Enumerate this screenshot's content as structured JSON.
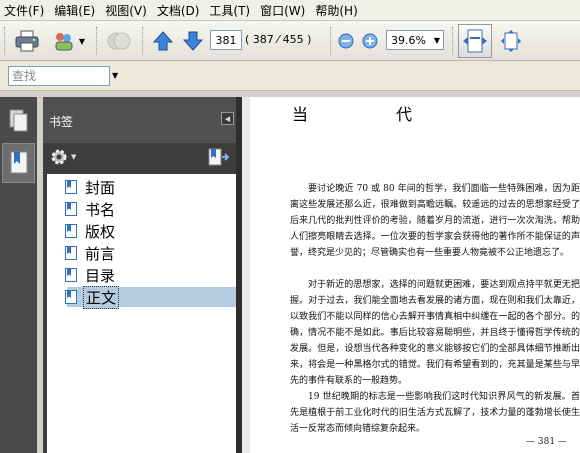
{
  "menu": [
    "文件(F)",
    "编辑(E)",
    "视图(V)",
    "文档(D)",
    "工具(T)",
    "窗口(W)",
    "帮助(H)"
  ],
  "toolbar": {
    "current_page": "381",
    "page_count": "( 387 ⁄ 455 )",
    "zoom": "39.6%",
    "icons": [
      "print-icon",
      "collaborate-icon",
      "security-icon",
      "previous-page-icon",
      "next-page-icon",
      "zoom-out-icon",
      "zoom-in-icon",
      "fit-width-icon",
      "fit-page-icon"
    ]
  },
  "find": {
    "placeholder": "查找"
  },
  "panel": {
    "title": "书签",
    "bookmarks": [
      {
        "label": "封面",
        "selected": false
      },
      {
        "label": "书名",
        "selected": false
      },
      {
        "label": "版权",
        "selected": false
      },
      {
        "label": "前言",
        "selected": false
      },
      {
        "label": "目录",
        "selected": false
      },
      {
        "label": "正文",
        "selected": true
      }
    ]
  },
  "document": {
    "heading": "当　代",
    "paragraphs": [
      "要讨论晚近 70 或 80 年间的哲学，我们面临一些特殊困难，因为距离这些发展还那么近，很难做到高瞻远瞩。较遥远的过去的思想家经受了后来几代的批判性评价的考验，随着岁月的流逝，进行一次次淘洗，帮助人们擦亮眼睛去选择。一位次要的哲学家会获得他的著作所不能保证的声誉，终究是少见的；尽管确实也有一些重要人物竟被不公正地遗忘了。",
      "对于新近的思想家，选择的问题就更困难，要达到观点持平就更无把握。对于过去，我们能全面地去看发展的诸方面，现在则和我们太靠近，以致我们不能以同样的信心去解开事情真相中纠缠在一起的各个部分。的确，情况不能不是如此。事后比较容易聪明些，并且终于懂得哲学传统的发展。但是，设想当代各种变化的意义能够按它们的全部具体细节推断出来，将会是一种黑格尔式的错觉。我们有希望看到的，充其量是某些与早先的事件有联系的一般趋势。",
      "19 世纪晚期的标志是一些影响我们这时代知识界风气的新发展。首先是植根于前工业化时代的旧生活方式瓦解了，技术力量的蓬勃增长使生活一反常态而倾向错综复杂起来。"
    ],
    "page_number": "— 381 —"
  }
}
